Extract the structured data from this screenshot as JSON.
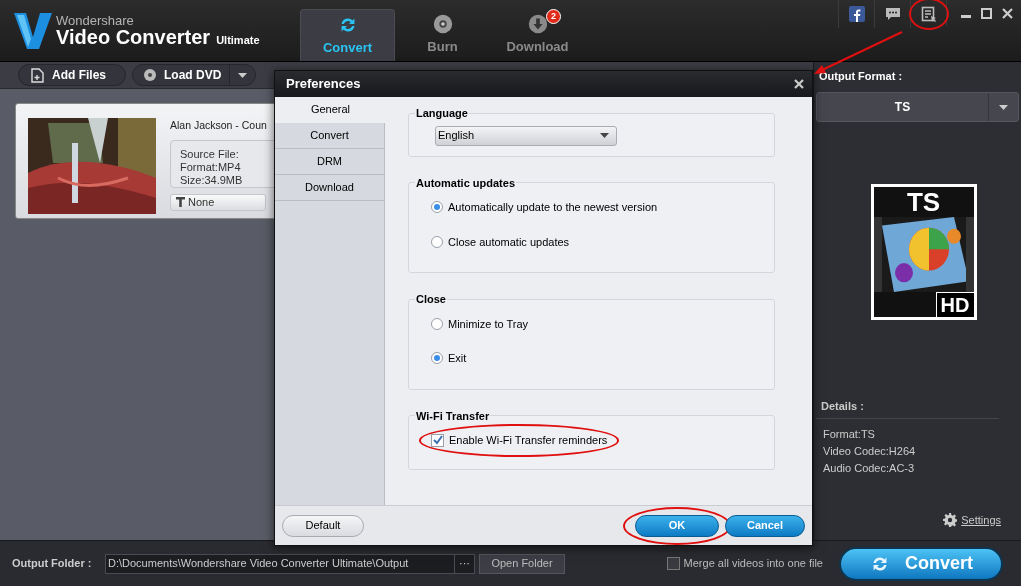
{
  "app": {
    "brand": "Wondershare",
    "product": "Video Converter",
    "edition": "Ultimate"
  },
  "tabs": [
    {
      "label": "Convert",
      "selected": true,
      "kind": "convert"
    },
    {
      "label": "Burn",
      "selected": false,
      "kind": "burn"
    },
    {
      "label": "Download",
      "selected": false,
      "kind": "download",
      "badge": "2"
    }
  ],
  "title_icons": [
    {
      "kind": "facebook",
      "highlighted": false
    },
    {
      "kind": "chat",
      "highlighted": false
    },
    {
      "kind": "preferences",
      "highlighted": true
    }
  ],
  "toolbar": {
    "add_files": "Add Files",
    "load_dvd": "Load DVD"
  },
  "file_item": {
    "title": "Alan Jackson - Coun",
    "details": [
      "Source File:",
      "Format:MP4",
      "Size:34.9MB"
    ],
    "subtitle": "None"
  },
  "output_panel": {
    "heading": "Output Format :",
    "format": "TS",
    "icon_label": "TS",
    "icon_badge": "HD",
    "details_heading": "Details :",
    "details": [
      "Format:TS",
      "Video Codec:H264",
      "Audio Codec:AC-3"
    ],
    "settings_link": "Settings"
  },
  "bottom_bar": {
    "folder_label": "Output Folder :",
    "folder_path": "D:\\Documents\\Wondershare Video Converter Ultimate\\Output",
    "browse": "···",
    "open_folder": "Open Folder",
    "merge": {
      "label": "Merge all videos into one file",
      "checked": false
    },
    "convert": "Convert"
  },
  "dialog": {
    "title": "Preferences",
    "nav": [
      {
        "label": "General",
        "selected": true
      },
      {
        "label": "Convert",
        "selected": false
      },
      {
        "label": "DRM",
        "selected": false
      },
      {
        "label": "Download",
        "selected": false
      }
    ],
    "sections": [
      {
        "kind": "select",
        "title": "Language",
        "value": "English"
      },
      {
        "kind": "radios",
        "title": "Automatic updates",
        "options": [
          {
            "label": "Automatically update to the newest version",
            "selected": true
          },
          {
            "label": "Close automatic updates",
            "selected": false
          }
        ]
      },
      {
        "kind": "radios",
        "title": "Close",
        "options": [
          {
            "label": "Minimize to Tray",
            "selected": false
          },
          {
            "label": "Exit",
            "selected": true
          }
        ]
      },
      {
        "kind": "checkbox",
        "title": "Wi-Fi Transfer",
        "options": [
          {
            "label": "Enable Wi-Fi Transfer reminders",
            "checked": true,
            "highlighted": true
          }
        ]
      }
    ],
    "buttons": [
      {
        "kind": "default",
        "label": "Default",
        "highlighted": false
      },
      {
        "kind": "ok",
        "label": "OK",
        "highlighted": true
      },
      {
        "kind": "cancel",
        "label": "Cancel",
        "highlighted": false
      }
    ]
  }
}
